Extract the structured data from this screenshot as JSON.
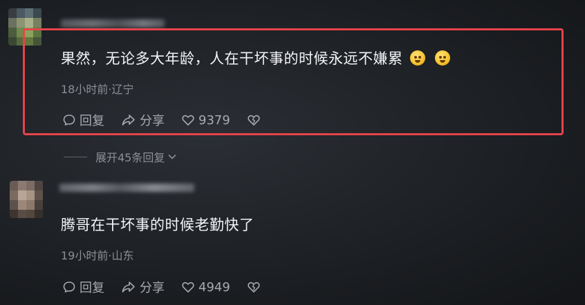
{
  "colors": {
    "background": "#17191d",
    "text_primary": "#f3f4f6",
    "text_meta": "#8c8f95",
    "highlight": "#e8434a"
  },
  "comments": [
    {
      "text": "果然，无论多大年龄，人在干坏事的时候永远不嫌累",
      "emojis": [
        "grin-emoji",
        "grin-emoji"
      ],
      "meta": "18小时前·辽宁",
      "reply_label": "回复",
      "share_label": "分享",
      "like_count": "9379",
      "highlighted": true
    },
    {
      "text": "腾哥在干坏事的时候老勤快了",
      "emojis": [],
      "meta": "19小时前·山东",
      "reply_label": "回复",
      "share_label": "分享",
      "like_count": "4949",
      "highlighted": false
    }
  ],
  "expand_replies": {
    "label": "展开45条回复"
  },
  "icons": {
    "reply": "comment-bubble-icon",
    "share": "share-arrow-icon",
    "like": "heart-icon",
    "dislike": "broken-heart-icon",
    "expand": "chevron-down-icon"
  }
}
